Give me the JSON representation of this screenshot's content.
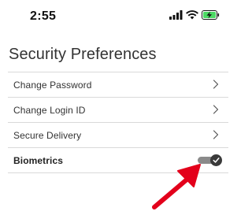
{
  "status_bar": {
    "time": "2:55",
    "icons": [
      "signal-icon",
      "wifi-icon",
      "battery-charging-icon"
    ],
    "battery_color": "#4cd964"
  },
  "page": {
    "title": "Security Preferences"
  },
  "settings": {
    "items": [
      {
        "label": "Change Password",
        "control": "chevron-right-icon"
      },
      {
        "label": "Change Login ID",
        "control": "chevron-right-icon"
      },
      {
        "label": "Secure Delivery",
        "control": "chevron-right-icon"
      },
      {
        "label": "Biometrics",
        "control": "toggle",
        "enabled": true
      }
    ]
  },
  "annotation": {
    "icon": "red-arrow-icon",
    "color": "#e3001b"
  }
}
